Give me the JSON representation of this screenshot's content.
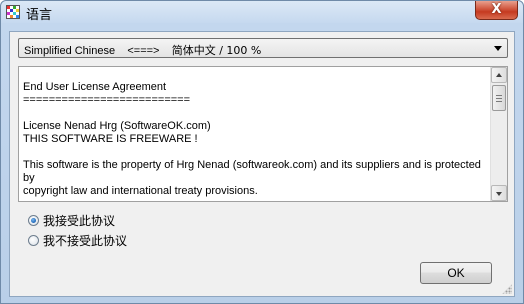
{
  "window": {
    "title": "语言",
    "close_glyph": "X"
  },
  "language_select": {
    "value_lang": "Simplified Chinese",
    "value_sep": "<===>",
    "value_native": "简体中文 / 100 %"
  },
  "license": {
    "lines": [
      "",
      "End User License Agreement",
      "==========================",
      "",
      "License Nenad Hrg (SoftwareOK.com)",
      "THIS SOFTWARE IS FREEWARE !",
      "",
      "This software is the property of Hrg Nenad (softwareok.com) and its suppliers and is protected by",
      "copyright law and international treaty provisions."
    ]
  },
  "options": {
    "accept": "我接受此协议",
    "decline": "我不接受此协议",
    "selected": "accept"
  },
  "buttons": {
    "ok": "OK"
  },
  "colors": {
    "title_bar": "#c6d9ef",
    "client_bg": "#f0f0f0",
    "close_button": "#c53a20"
  }
}
